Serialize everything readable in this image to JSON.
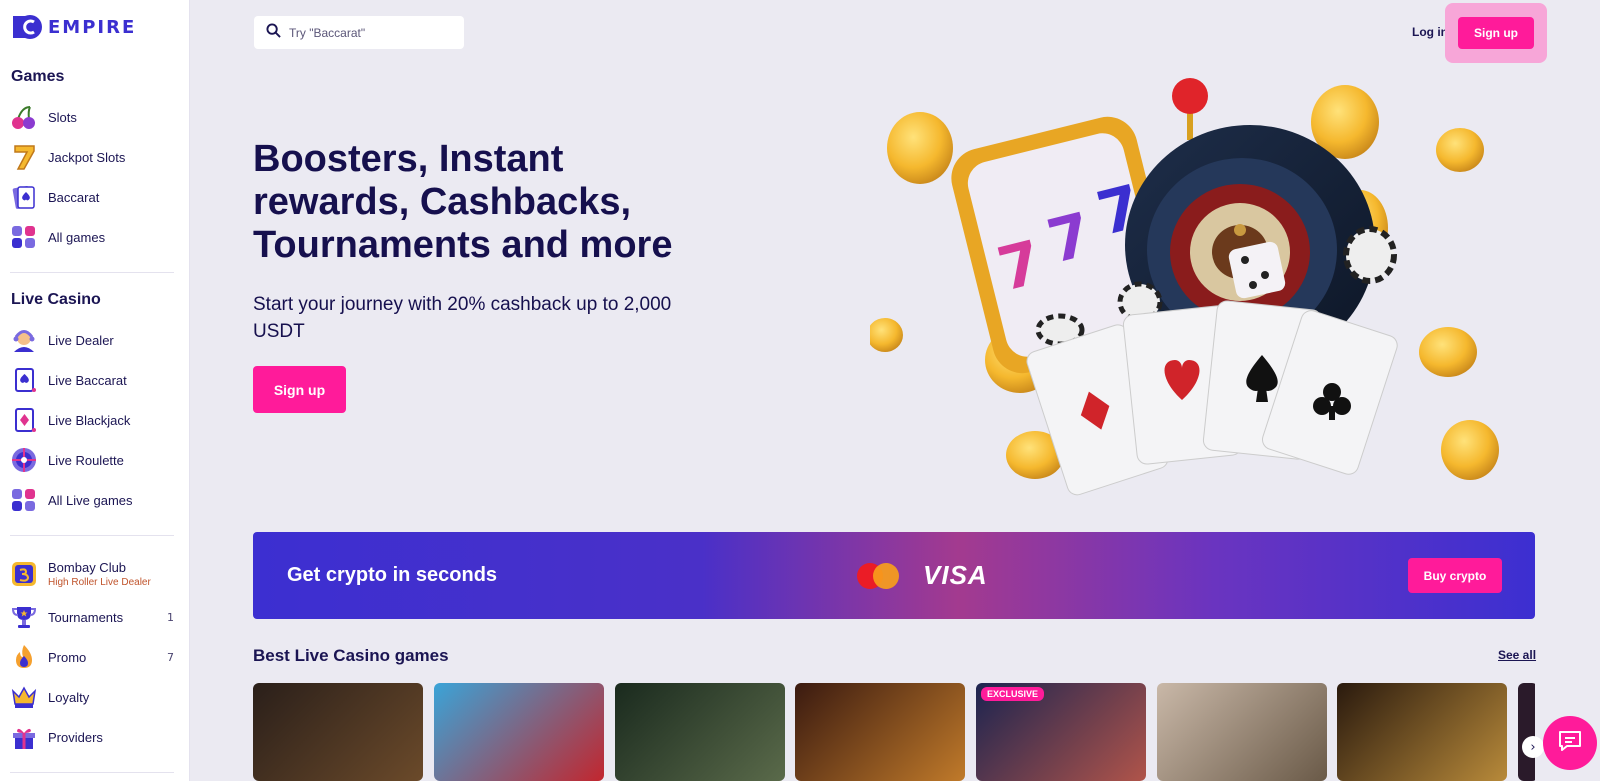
{
  "brand": {
    "name": "EMPIRE",
    "accent": "#3b2fd0",
    "pink": "#ff1b9a"
  },
  "sidebar": {
    "games_title": "Games",
    "games": [
      {
        "label": "Slots",
        "icon": "cherries-icon"
      },
      {
        "label": "Jackpot Slots",
        "icon": "seven-icon"
      },
      {
        "label": "Baccarat",
        "icon": "card-spade-icon"
      },
      {
        "label": "All games",
        "icon": "grid-icon"
      }
    ],
    "live_title": "Live Casino",
    "live": [
      {
        "label": "Live Dealer",
        "icon": "dealer-icon"
      },
      {
        "label": "Live Baccarat",
        "icon": "card-spade-icon"
      },
      {
        "label": "Live Blackjack",
        "icon": "card-diamond-icon"
      },
      {
        "label": "Live Roulette",
        "icon": "roulette-icon"
      },
      {
        "label": "All Live games",
        "icon": "grid-icon"
      }
    ],
    "extra": [
      {
        "label": "Bombay Club",
        "sub": "High Roller Live Dealer",
        "icon": "bombay-icon"
      },
      {
        "label": "Tournaments",
        "count": "1",
        "icon": "trophy-icon"
      },
      {
        "label": "Promo",
        "count": "7",
        "icon": "flame-icon"
      },
      {
        "label": "Loyalty",
        "icon": "crown-icon"
      },
      {
        "label": "Providers",
        "icon": "gift-icon"
      }
    ]
  },
  "header": {
    "search_placeholder": "Try \"Baccarat\"",
    "login_label": "Log in",
    "signup_label": "Sign up"
  },
  "hero": {
    "title": "Boosters, Instant rewards, Cashbacks, Tournaments and more",
    "subtitle": "Start your journey with 20% cashback up to 2,000 USDT",
    "cta_label": "Sign up"
  },
  "banner": {
    "text": "Get crypto in seconds",
    "visa": "VISA",
    "buy_label": "Buy crypto"
  },
  "best_live": {
    "title": "Best Live Casino games",
    "see_all": "See all",
    "exclusive_badge": "EXCLUSIVE",
    "games": [
      {
        "name": "live-dealer-game-1",
        "colors": [
          "#2a1f1a",
          "#6b4a2a"
        ]
      },
      {
        "name": "crazy-time-game",
        "colors": [
          "#3aa4d8",
          "#c2262e"
        ]
      },
      {
        "name": "instant-roulette-game",
        "colors": [
          "#1a2a1e",
          "#5a6a4a"
        ]
      },
      {
        "name": "dragon-tiger-game",
        "colors": [
          "#3a1a10",
          "#c07a2a"
        ]
      },
      {
        "name": "exclusive-game",
        "colors": [
          "#1c2450",
          "#b0544a"
        ]
      },
      {
        "name": "blackjack-dealer-game",
        "colors": [
          "#c9b8a8",
          "#6a5a48"
        ]
      },
      {
        "name": "bombay-club-game",
        "colors": [
          "#2a1a0e",
          "#b88a3a"
        ]
      }
    ]
  }
}
